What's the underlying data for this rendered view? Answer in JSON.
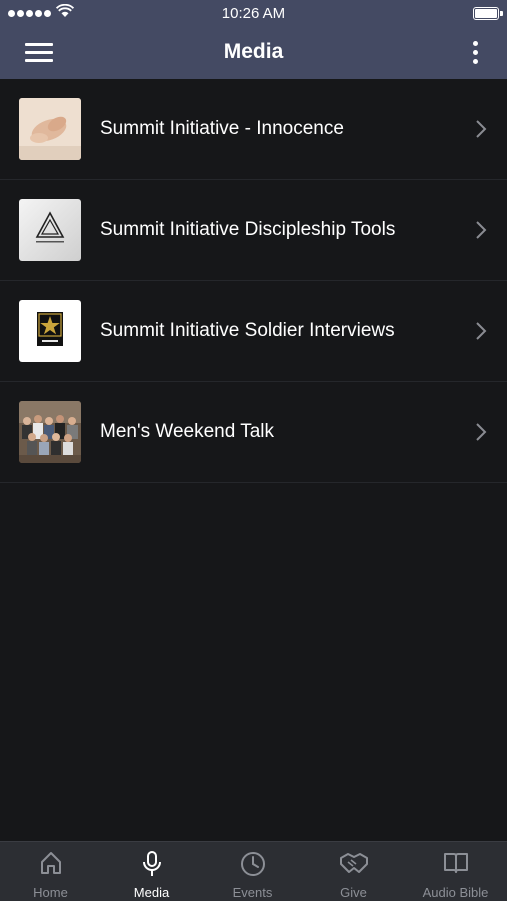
{
  "status_bar": {
    "time": "10:26 AM"
  },
  "header": {
    "title": "Media"
  },
  "items": [
    {
      "label": "Summit Initiative - Innocence"
    },
    {
      "label": "Summit Initiative Discipleship Tools"
    },
    {
      "label": "Summit Initiative Soldier Interviews"
    },
    {
      "label": "Men's Weekend Talk"
    }
  ],
  "tabs": [
    {
      "label": "Home",
      "icon": "home-icon"
    },
    {
      "label": "Media",
      "icon": "microphone-icon",
      "active": true
    },
    {
      "label": "Events",
      "icon": "clock-icon"
    },
    {
      "label": "Give",
      "icon": "handshake-icon"
    },
    {
      "label": "Audio Bible",
      "icon": "book-icon"
    }
  ],
  "colors": {
    "header": "#444a63",
    "background": "#161719",
    "tabbar": "#2c2e33",
    "tab_inactive": "#8c8f96"
  }
}
